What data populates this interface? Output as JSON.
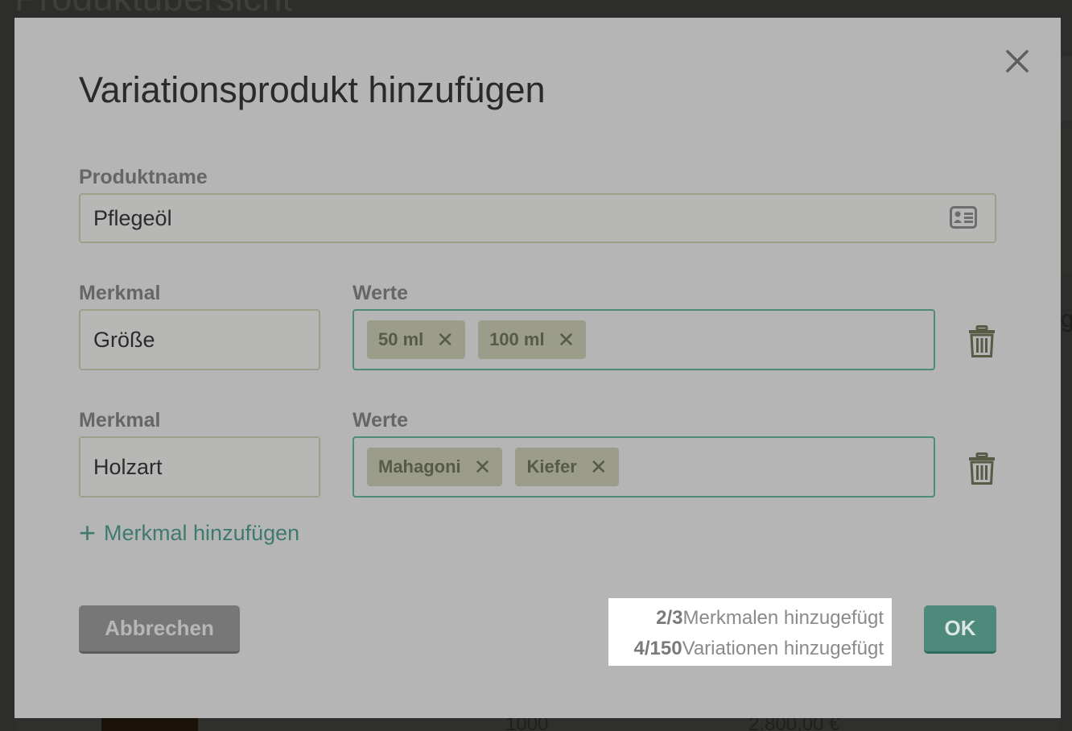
{
  "background": {
    "page_title": "Produktübersicht",
    "row_cells": [
      "1000",
      "2.800,00 €"
    ]
  },
  "dialog": {
    "title": "Variationsprodukt hinzufügen",
    "product_name_label": "Produktname",
    "product_name_value": "Pflegeöl",
    "attributes": [
      {
        "label": "Merkmal",
        "value": "Größe",
        "values_label": "Werte",
        "tags": [
          "50 ml",
          "100 ml"
        ]
      },
      {
        "label": "Merkmal",
        "value": "Holzart",
        "values_label": "Werte",
        "tags": [
          "Mahagoni",
          "Kiefer"
        ]
      }
    ],
    "add_attribute_label": "Merkmal hinzufügen",
    "cancel_label": "Abbrechen",
    "ok_label": "OK",
    "counters": {
      "attributes_count": "2/3",
      "attributes_text": "Merkmalen hinzugefügt",
      "variations_count": "4/150",
      "variations_text": "Variationen hinzugefügt"
    }
  },
  "icons": {
    "close": "close-icon",
    "contact_card": "contact-card-icon",
    "trash": "trash-icon",
    "plus": "plus-icon",
    "tag_remove": "remove-tag-icon"
  },
  "colors": {
    "accent": "#4e8a7c",
    "overlay": "#b5b5b5",
    "cancel_button": "#777777"
  }
}
